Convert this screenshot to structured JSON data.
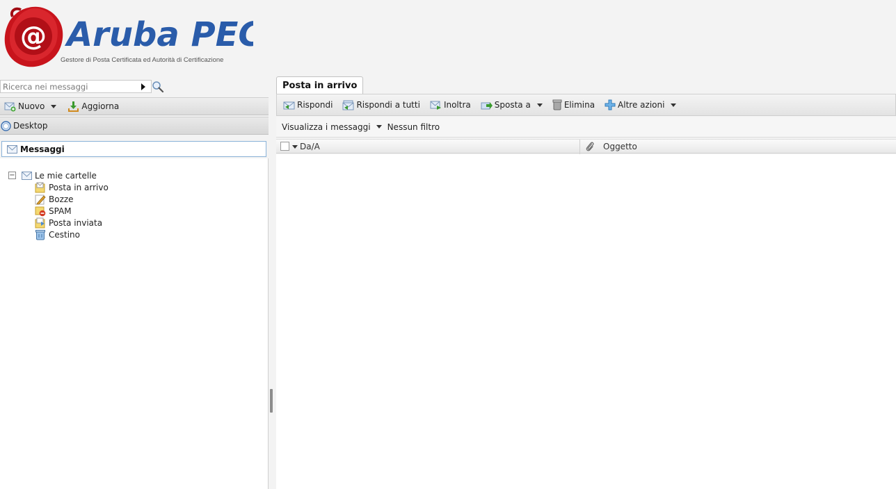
{
  "header": {
    "logo_text": "Aruba PEC",
    "tagline": "Gestore di Posta Certificata ed Autorità di Certificazione"
  },
  "search": {
    "placeholder": "Ricerca nei messaggi"
  },
  "left_toolbar": {
    "new_label": "Nuovo",
    "refresh_label": "Aggiorna"
  },
  "desktop": {
    "label": "Desktop"
  },
  "messages": {
    "label": "Messaggi"
  },
  "folders": {
    "root_label": "Le mie cartelle",
    "items": [
      {
        "label": "Posta in arrivo",
        "icon": "inbox-folder-icon"
      },
      {
        "label": "Bozze",
        "icon": "drafts-pencil-icon"
      },
      {
        "label": "SPAM",
        "icon": "spam-folder-icon"
      },
      {
        "label": "Posta inviata",
        "icon": "sent-folder-icon"
      },
      {
        "label": "Cestino",
        "icon": "trash-bin-icon"
      }
    ]
  },
  "tab": {
    "label": "Posta in arrivo"
  },
  "actions": {
    "reply": "Rispondi",
    "reply_all": "Rispondi a tutti",
    "forward": "Inoltra",
    "move_to": "Sposta a",
    "delete": "Elimina",
    "more_actions": "Altre azioni"
  },
  "filter_bar": {
    "view_messages": "Visualizza i messaggi",
    "no_filter": "Nessun filtro"
  },
  "columns": {
    "from_to": "Da/A",
    "subject": "Oggetto"
  },
  "colors": {
    "brand_red": "#c8141c",
    "logo_blue": "#2a5caa",
    "selection_border": "#8ab2d8"
  }
}
